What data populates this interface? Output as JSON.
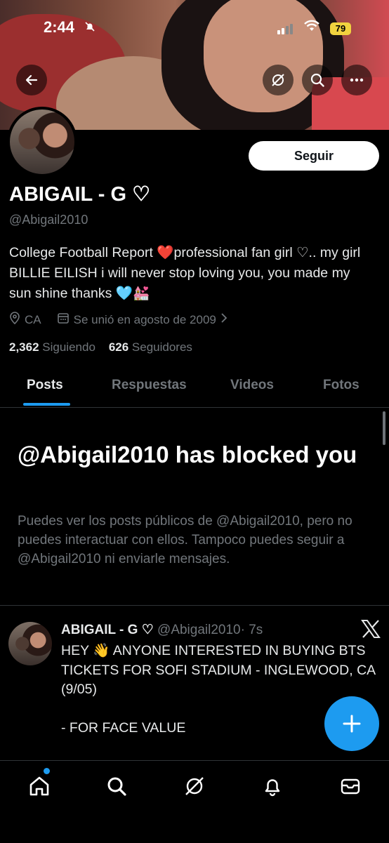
{
  "status_bar": {
    "time": "2:44",
    "battery": "79"
  },
  "header": {
    "back_icon": "arrow-left-icon",
    "grok_icon": "grok-icon",
    "search_icon": "search-icon",
    "more_icon": "more-icon"
  },
  "profile": {
    "follow_label": "Seguir",
    "name": "ABIGAIL - G ♡",
    "handle": "@Abigail2010",
    "bio": "College Football Report ❤️professional fan girl ♡.. my girl BILLIE EILISH i will never stop loving you, you made my sun shine thanks 🩵💒",
    "location": "CA",
    "joined": "Se unió en agosto de 2009",
    "following_count": "2,362",
    "following_label": "Siguiendo",
    "followers_count": "626",
    "followers_label": "Seguidores"
  },
  "tabs": [
    "Posts",
    "Respuestas",
    "Videos",
    "Fotos"
  ],
  "blocked": {
    "title": "@Abigail2010 has blocked you",
    "description": "Puedes ver los posts públicos de @Abigail2010, pero no puedes interactuar con ellos. Tampoco puedes seguir a @Abigail2010 ni enviarle mensajes."
  },
  "tweet": {
    "name": "ABIGAIL - G ♡",
    "handle": "@Abigail2010",
    "time": "· 7s",
    "body": "HEY 👋 ANYONE INTERESTED IN BUYING BTS TICKETS FOR SOFI STADIUM - INGLEWOOD, CA (9/05)\n\n- FOR FACE VALUE\n\nSend a DM if interested"
  },
  "colors": {
    "accent": "#1d9bf0",
    "muted": "#71767b",
    "battery": "#f1d33f"
  }
}
